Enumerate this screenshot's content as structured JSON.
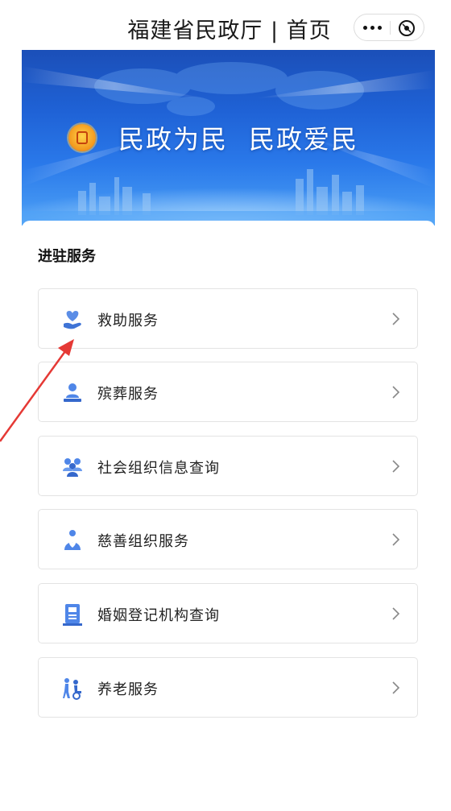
{
  "header": {
    "title": "福建省民政厅 | 首页",
    "more_icon": "more-icon",
    "close_icon": "close-circle-icon"
  },
  "banner": {
    "slogan_part1": "民政为民",
    "slogan_part2": "民政爱民",
    "emblem_icon": "civil-affairs-emblem-icon"
  },
  "section": {
    "title": "进驻服务"
  },
  "services": [
    {
      "label": "救助服务",
      "icon": "hand-heart-icon"
    },
    {
      "label": "殡葬服务",
      "icon": "memorial-icon"
    },
    {
      "label": "社会组织信息查询",
      "icon": "group-icon"
    },
    {
      "label": "慈善组织服务",
      "icon": "charity-person-icon"
    },
    {
      "label": "婚姻登记机构查询",
      "icon": "certificate-icon"
    },
    {
      "label": "养老服务",
      "icon": "elderly-care-icon"
    }
  ],
  "colors": {
    "accent": "#4f86e8",
    "annotation_arrow": "#e53935",
    "banner_top": "#1b4fb8",
    "banner_bottom": "#4ea2f6"
  }
}
